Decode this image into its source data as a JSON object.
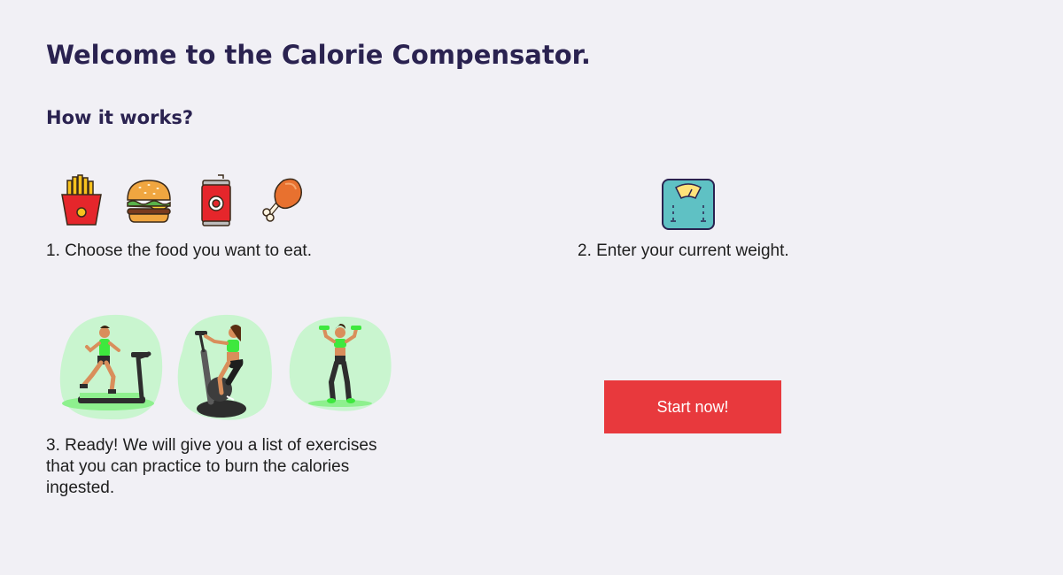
{
  "page": {
    "title": "Welcome to the Calorie Compensator.",
    "subtitle": "How it works?"
  },
  "steps": [
    {
      "text": "1. Choose the food you want to eat.",
      "icons": [
        "fries-icon",
        "burger-icon",
        "soda-can-icon",
        "chicken-leg-icon"
      ]
    },
    {
      "text": "2. Enter your current weight.",
      "icons": [
        "weight-scale-icon"
      ]
    },
    {
      "text": "3. Ready! We will give you a list of exercises that you can practice to burn the calories ingested.",
      "icons": [
        "treadmill-illustration",
        "exercise-bike-illustration",
        "dumbbells-illustration"
      ]
    }
  ],
  "actions": {
    "start_label": "Start now!"
  },
  "colors": {
    "background": "#f1f0f5",
    "heading": "#2a2250",
    "button": "#e8393d",
    "accent_green": "#c9f5cf"
  }
}
